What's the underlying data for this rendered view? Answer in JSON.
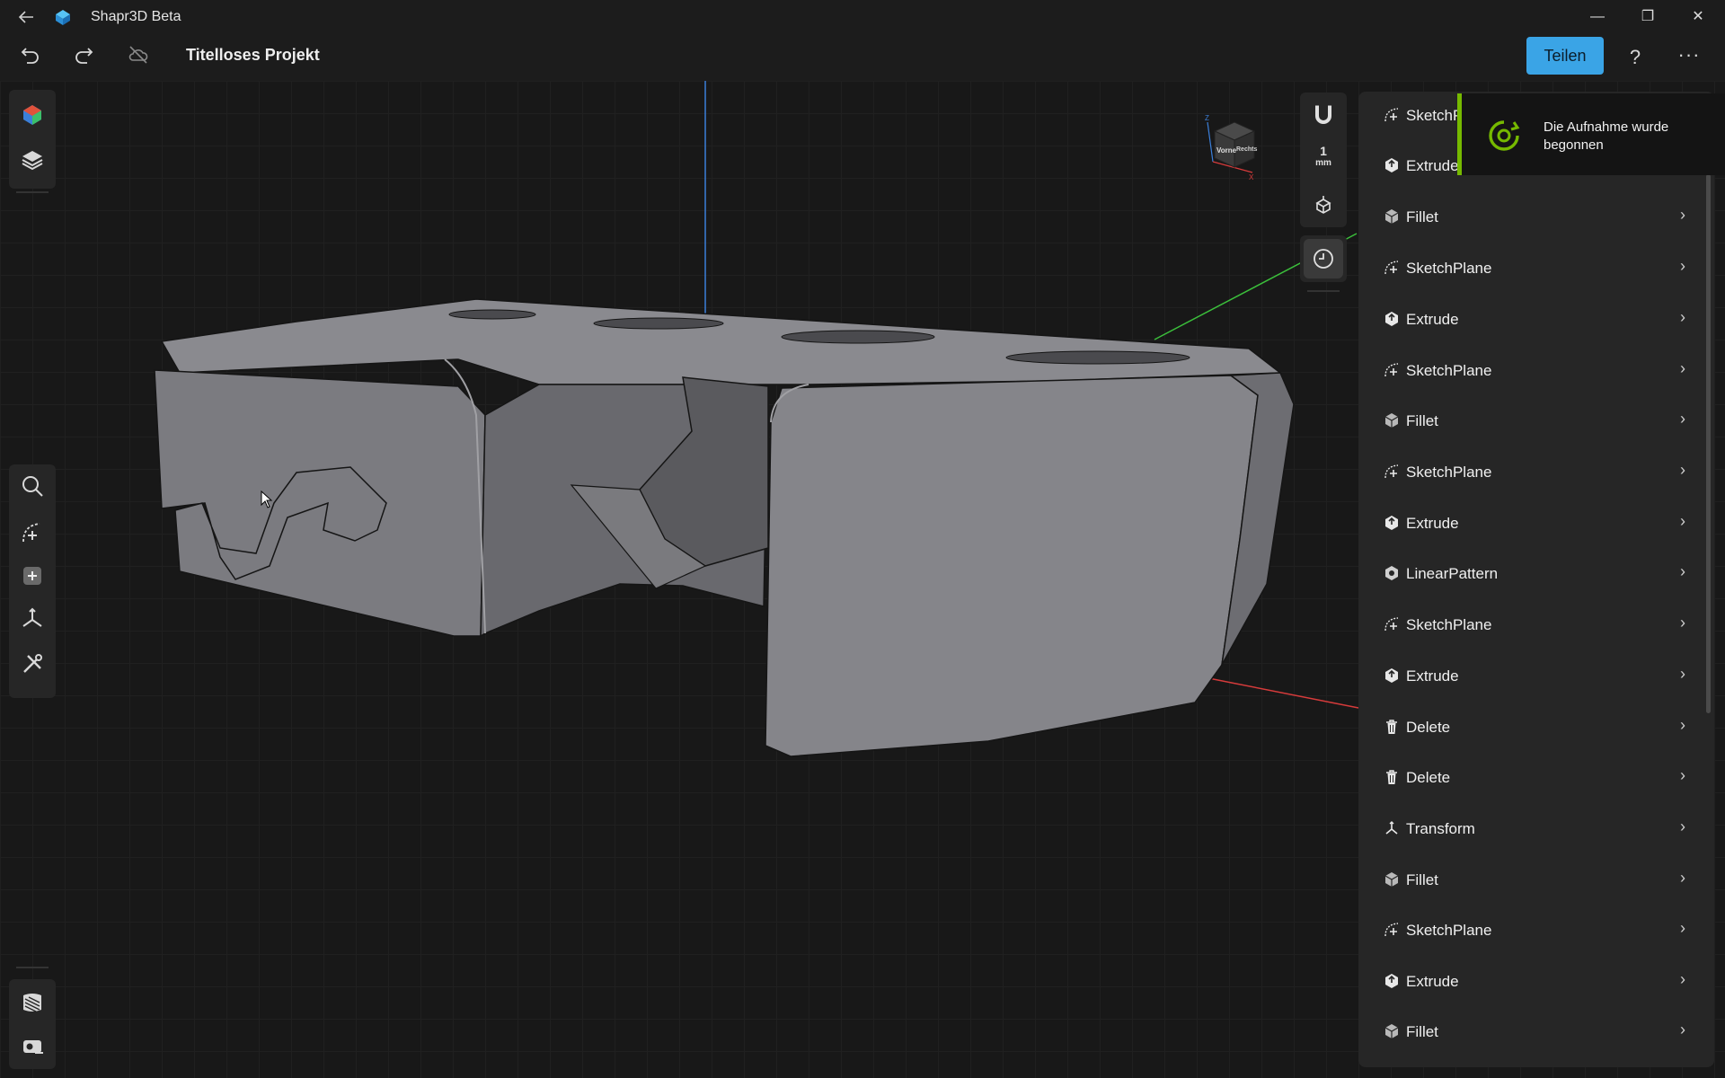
{
  "titlebar": {
    "app_title": "Shapr3D Beta",
    "back_icon": "back-arrow-icon",
    "minimize_glyph": "—",
    "maximize_glyph": "❐",
    "close_glyph": "✕"
  },
  "toolbar": {
    "undo_icon": "undo-icon",
    "redo_icon": "redo-icon",
    "cloud_icon": "cloud-off-icon",
    "project_title": "Titelloses Projekt",
    "share_label": "Teilen",
    "help_label": "?",
    "more_label": "···"
  },
  "left_toolbar": {
    "top_items": [
      "appearance-icon",
      "layers-icon"
    ],
    "mid_items": [
      "search-icon",
      "sketch-icon",
      "add-body-icon",
      "transform-icon",
      "tools-icon"
    ],
    "bottom_items": [
      "material-icon",
      "measure-icon"
    ]
  },
  "view_controls": {
    "snap_icon": "magnet-icon",
    "unit_value": "1",
    "unit_label": "mm",
    "view_icon": "view-cube-icon",
    "history_icon": "history-icon"
  },
  "view_cube": {
    "face_front": "Vorne",
    "face_right": "Rechts",
    "axis_z": "Z",
    "axis_x": "X"
  },
  "timeline": {
    "items": [
      {
        "label": "SketchPlane",
        "icon": "sketchplane-icon"
      },
      {
        "label": "Extrude",
        "icon": "extrude-icon"
      },
      {
        "label": "Fillet",
        "icon": "fillet-icon"
      },
      {
        "label": "SketchPlane",
        "icon": "sketchplane-icon"
      },
      {
        "label": "Extrude",
        "icon": "extrude-icon"
      },
      {
        "label": "SketchPlane",
        "icon": "sketchplane-icon"
      },
      {
        "label": "Fillet",
        "icon": "fillet-icon"
      },
      {
        "label": "SketchPlane",
        "icon": "sketchplane-icon"
      },
      {
        "label": "Extrude",
        "icon": "extrude-icon"
      },
      {
        "label": "LinearPattern",
        "icon": "linearpattern-icon"
      },
      {
        "label": "SketchPlane",
        "icon": "sketchplane-icon"
      },
      {
        "label": "Extrude",
        "icon": "extrude-icon"
      },
      {
        "label": "Delete",
        "icon": "trash-icon"
      },
      {
        "label": "Delete",
        "icon": "trash-icon"
      },
      {
        "label": "Transform",
        "icon": "transform-icon"
      },
      {
        "label": "Fillet",
        "icon": "fillet-icon"
      },
      {
        "label": "SketchPlane",
        "icon": "sketchplane-icon"
      },
      {
        "label": "Extrude",
        "icon": "extrude-icon"
      },
      {
        "label": "Fillet",
        "icon": "fillet-icon"
      }
    ],
    "chevron": "›"
  },
  "toast": {
    "text": "Die Aufnahme wurde begonnen",
    "icon": "recording-icon",
    "accent": "#76b900"
  },
  "colors": {
    "share_button": "#3aa4e6",
    "axis_z": "#3b7fd9",
    "axis_y": "#3bbf3b",
    "axis_x": "#d63b3b"
  }
}
